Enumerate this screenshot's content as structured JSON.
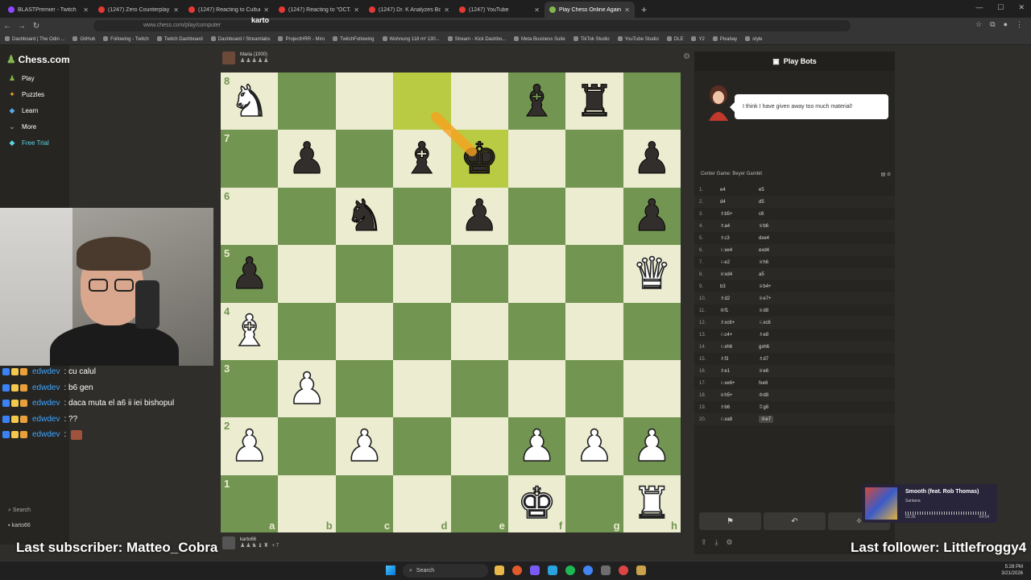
{
  "browser": {
    "tabs": [
      {
        "label": "BLASTPremier - Twitch",
        "fav": "tw"
      },
      {
        "label": "(1247) Zero Counterplay Onesh",
        "fav": "yt"
      },
      {
        "label": "(1247) Reacting to Culture by",
        "fav": "yt"
      },
      {
        "label": "(1247) Reacting to \"OCTANE\" b",
        "fav": "yt"
      },
      {
        "label": "(1247) Dr. K Analyzes Bobby Le",
        "fav": "yt"
      },
      {
        "label": "(1247) YouTube",
        "fav": "yt"
      },
      {
        "label": "Play Chess Online Against the C",
        "fav": "cc",
        "active": true
      }
    ],
    "url": "www.chess.com/play/computer",
    "bookmarks": [
      "Dashboard | The Odin ...",
      "GitHub",
      "Following - Twitch",
      "Twitch Dashboard",
      "Dashboard / Streamlabs",
      "ProjectHRR - Miro",
      "TwitchFollowing",
      "Wohnung 118 m² 130...",
      "Stream - Kick Dashbo...",
      "Meta Business Suite",
      "TikTok Studio",
      "YouTube Studio",
      "DLE",
      "Y2",
      "Pixabay",
      "style"
    ]
  },
  "sidebar": {
    "logo": "Chess.com",
    "items": [
      {
        "label": "Play",
        "icon": "♟"
      },
      {
        "label": "Puzzles",
        "icon": "✦"
      },
      {
        "label": "Learn",
        "icon": "◆"
      },
      {
        "label": "More",
        "icon": "⌄"
      },
      {
        "label": "Free Trial",
        "icon": "◆"
      }
    ],
    "search": "Search",
    "user": "karto66"
  },
  "stream": {
    "cam_name": "karto",
    "chat": [
      {
        "user": "edwdev",
        "text": ": cu calul"
      },
      {
        "user": "edwdev",
        "text": ": b6 gen"
      },
      {
        "user": "edwdev",
        "text": ": daca muta el a6 ii iei bishopul"
      },
      {
        "user": "edwdev",
        "text": ": ??"
      },
      {
        "user": "edwdev",
        "text": ":",
        "emote": true
      }
    ],
    "last_subscriber": "Last subscriber: Matteo_Cobra",
    "last_follower": "Last follower: Littlefroggy4",
    "music": {
      "title": "Smooth (feat. Rob Thomas)",
      "artist": "Santana",
      "elapsed": "03:36",
      "total": "04:54"
    }
  },
  "game": {
    "top_player": {
      "name": "Maria (1000)",
      "captured": "♟♟♟♟♟"
    },
    "bottom_player": {
      "name": "karto66",
      "captured": "♟♟♞♝♜",
      "diff": "+7"
    },
    "board": [
      [
        "wN",
        "",
        "",
        "",
        "",
        "bB",
        "bR",
        ""
      ],
      [
        "",
        "bP",
        "",
        "bB",
        "bK",
        "",
        "",
        "bP"
      ],
      [
        "",
        "",
        "bN",
        "",
        "bP",
        "",
        "",
        "bP"
      ],
      [
        "bP",
        "",
        "",
        "",
        "",
        "",
        "",
        "wQ"
      ],
      [
        "wB",
        "",
        "",
        "",
        "",
        "",
        "",
        ""
      ],
      [
        "",
        "wP",
        "",
        "",
        "",
        "",
        "",
        ""
      ],
      [
        "wP",
        "",
        "wP",
        "",
        "",
        "wP",
        "wP",
        "wP"
      ],
      [
        "",
        "",
        "",
        "",
        "",
        "wK",
        "",
        "wR"
      ]
    ],
    "highlighted": [
      "d8",
      "e7"
    ],
    "ranks": [
      "8",
      "7",
      "6",
      "5",
      "4",
      "3",
      "2",
      "1"
    ],
    "files": [
      "a",
      "b",
      "c",
      "d",
      "e",
      "f",
      "g",
      "h"
    ]
  },
  "panel": {
    "title": "Play Bots",
    "bot_message": "I think I have given away too much material!",
    "opening": "Center Game: Beyer Gambit",
    "moves": [
      [
        "1.",
        "e4",
        "e5"
      ],
      [
        "2.",
        "d4",
        "d5"
      ],
      [
        "3.",
        "♗b5+",
        "c6"
      ],
      [
        "4.",
        "♗a4",
        "♕b6"
      ],
      [
        "5.",
        "♗c3",
        "dxe4"
      ],
      [
        "6.",
        "♘xe4",
        "exd4"
      ],
      [
        "7.",
        "♘e2",
        "♕h6"
      ],
      [
        "8.",
        "♕xd4",
        "a5"
      ],
      [
        "9.",
        "b3",
        "♕b4+"
      ],
      [
        "10.",
        "♗d2",
        "♕e7+"
      ],
      [
        "11.",
        "♔f1",
        "♕d8"
      ],
      [
        "12.",
        "♗xc6+",
        "♘xc6"
      ],
      [
        "13.",
        "♘c4+",
        "♗e8"
      ],
      [
        "14.",
        "♘xh6",
        "gxh6"
      ],
      [
        "15.",
        "♗f3",
        "♗d7"
      ],
      [
        "16.",
        "♗e1",
        "♕e6"
      ],
      [
        "17.",
        "♘xe6+",
        "fxe6"
      ],
      [
        "18.",
        "♕h5+",
        "♔d8"
      ],
      [
        "19.",
        "♗b6",
        "♖g8"
      ],
      [
        "20.",
        "♘xa8",
        "♔e7"
      ]
    ]
  },
  "taskbar": {
    "search": "Search",
    "time": "5:28 PM",
    "date": "3/21/2026"
  }
}
